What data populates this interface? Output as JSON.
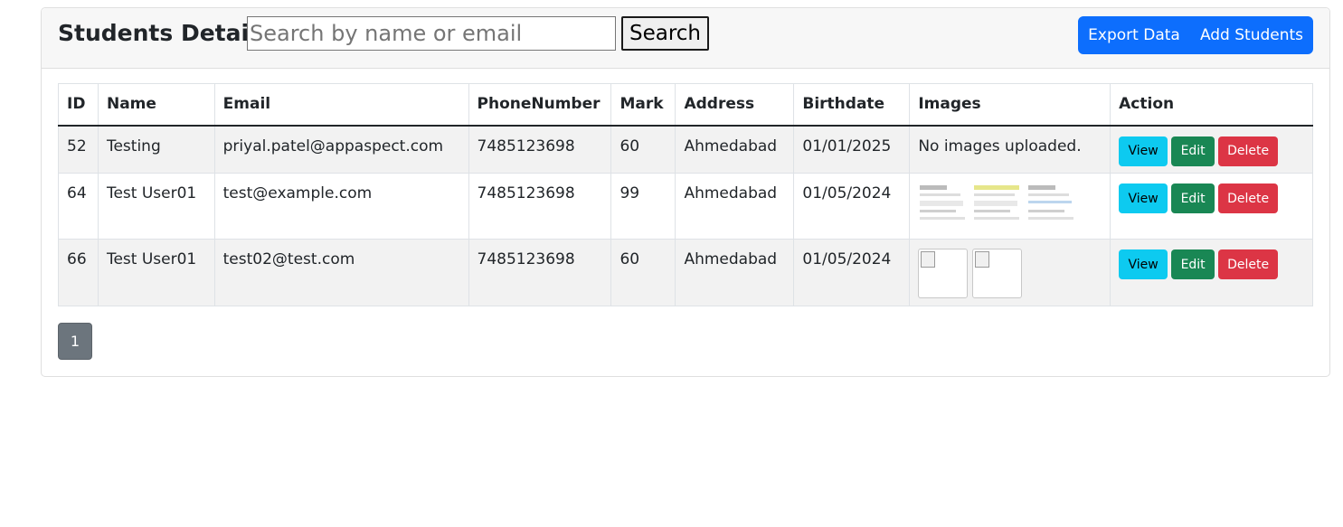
{
  "header": {
    "title": "Students Details",
    "search_placeholder": "Search by name or email",
    "search_value": "",
    "search_label": "Search",
    "export_label": "Export Data",
    "add_label": "Add Students"
  },
  "table": {
    "columns": [
      "ID",
      "Name",
      "Email",
      "PhoneNumber",
      "Mark",
      "Address",
      "Birthdate",
      "Images",
      "Action"
    ],
    "rows": [
      {
        "id": "52",
        "name": "Testing",
        "email": "priyal.patel@appaspect.com",
        "phone": "7485123698",
        "mark": "60",
        "address": "Ahmedabad",
        "birthdate": "01/01/2025",
        "images_text": "No images uploaded."
      },
      {
        "id": "64",
        "name": "Test User01",
        "email": "test@example.com",
        "phone": "7485123698",
        "mark": "99",
        "address": "Ahmedabad",
        "birthdate": "01/05/2024"
      },
      {
        "id": "66",
        "name": "Test User01",
        "email": "test02@test.com",
        "phone": "7485123698",
        "mark": "60",
        "address": "Ahmedabad",
        "birthdate": "01/05/2024"
      }
    ],
    "actions": {
      "view": "View",
      "edit": "Edit",
      "delete": "Delete"
    }
  },
  "pagination": {
    "current_page": "1"
  },
  "colors": {
    "primary": "#0d6efd",
    "info": "#0dcaf0",
    "success": "#198754",
    "danger": "#dc3545",
    "secondary": "#6c757d"
  }
}
